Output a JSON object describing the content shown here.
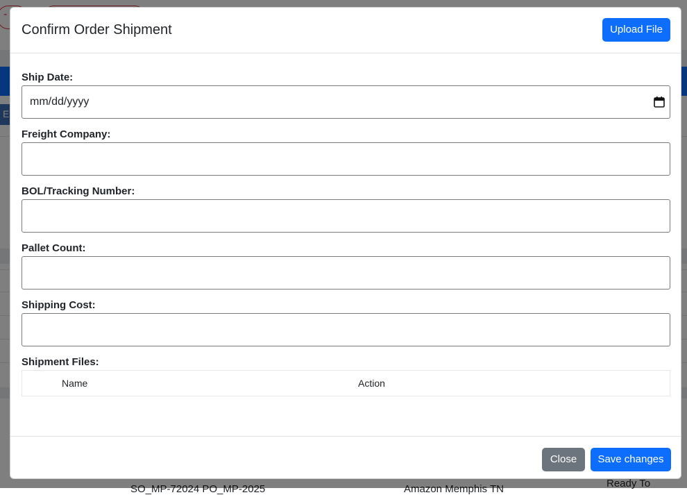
{
  "background": {
    "dash": "-",
    "blue_tab_letter": "E",
    "row_text_left": "SO_MP-72024 PO_MP-2025",
    "row_text_mid": "Amazon Memphis TN",
    "row_text_right": "Ready To"
  },
  "modal": {
    "title": "Confirm Order Shipment",
    "upload_label": "Upload File",
    "fields": {
      "ship_date": {
        "label": "Ship Date:",
        "placeholder": "mm/dd/yyyy"
      },
      "freight_company": {
        "label": "Freight Company:",
        "value": ""
      },
      "tracking_number": {
        "label": "BOL/Tracking Number:",
        "value": ""
      },
      "pallet_count": {
        "label": "Pallet Count:",
        "value": ""
      },
      "shipping_cost": {
        "label": "Shipping Cost:",
        "value": ""
      }
    },
    "files": {
      "label": "Shipment Files:",
      "columns": [
        "Name",
        "Action"
      ],
      "rows": []
    },
    "footer": {
      "close_label": "Close",
      "save_label": "Save changes"
    }
  },
  "colors": {
    "primary": "#0d6efd",
    "secondary": "#6c757d",
    "danger": "#dc3545"
  },
  "icons": {
    "calendar": "calendar-icon"
  }
}
